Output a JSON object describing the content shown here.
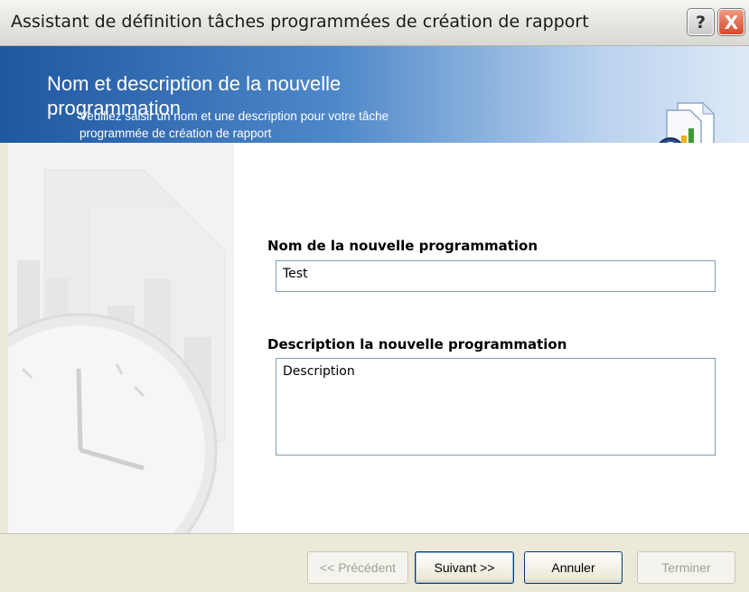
{
  "window": {
    "title": "Assistant de définition tâches programmées de création de rapport",
    "help_label": "?",
    "close_label": "X"
  },
  "banner": {
    "heading_line1": "Nom et description de la nouvelle",
    "heading_line2": "programmation",
    "subtitle_line1": "Veuillez saisir un nom et une description pour votre tâche",
    "subtitle_line2": "programmée de création de rapport",
    "icon": "report-clock-icon"
  },
  "form": {
    "name_label": "Nom de la nouvelle programmation",
    "name_value": "Test",
    "description_label": "Description la nouvelle programmation",
    "description_value": "Description"
  },
  "buttons": {
    "previous": "<< Précédent",
    "next": "Suivant >>",
    "cancel": "Annuler",
    "finish": "Terminer"
  }
}
